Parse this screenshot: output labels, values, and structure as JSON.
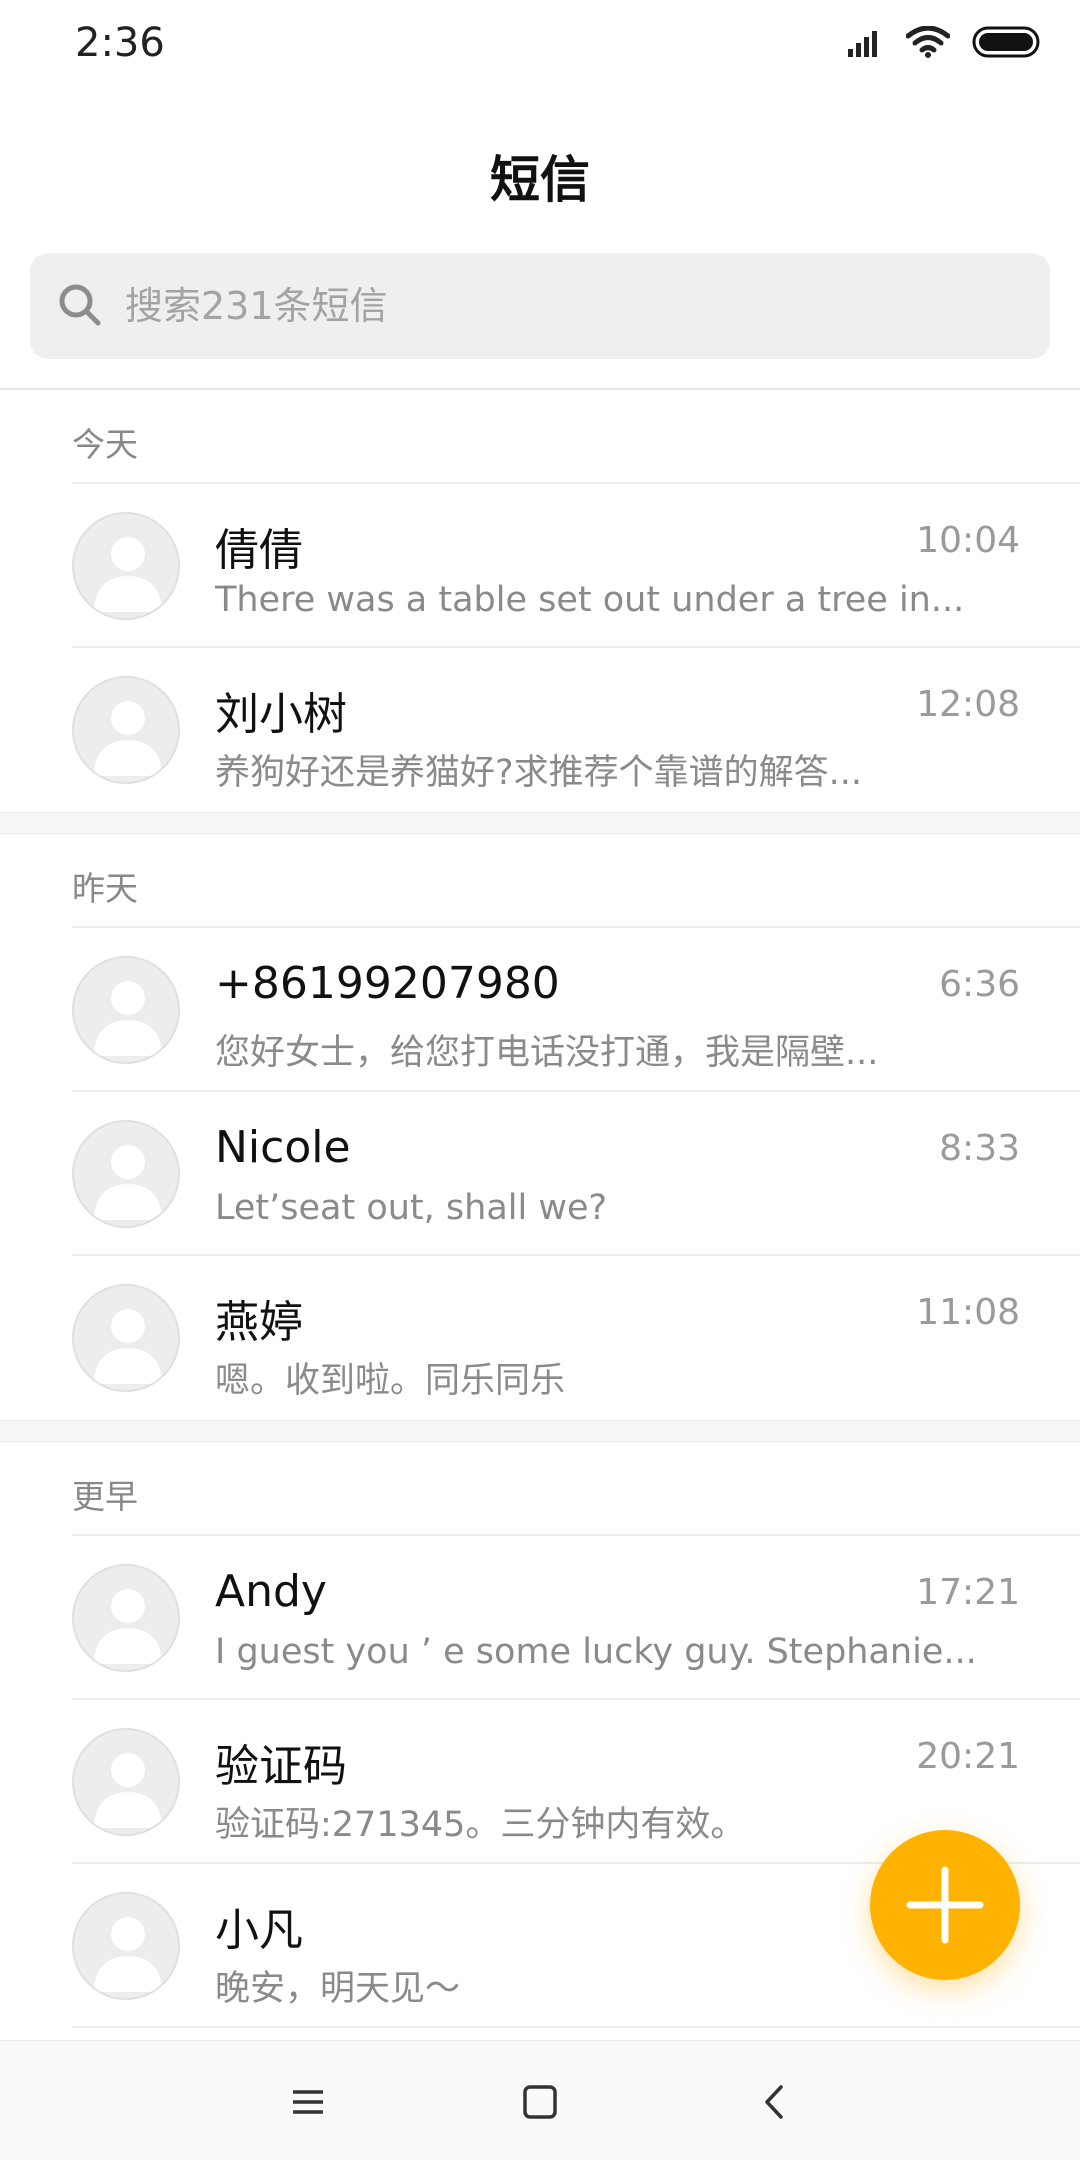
{
  "status_bar": {
    "time": "2:36"
  },
  "header": {
    "title": "短信"
  },
  "search": {
    "placeholder": "搜索231条短信"
  },
  "sections": [
    {
      "label": "今天",
      "conversations": [
        {
          "name": "倩倩",
          "time": "10:04",
          "preview": "There was a table set out under a tree in..."
        },
        {
          "name": "刘小树",
          "time": "12:08",
          "preview": "养狗好还是养猫好?求推荐个靠谱的解答..."
        }
      ]
    },
    {
      "label": "昨天",
      "conversations": [
        {
          "name": "+86199207980",
          "time": "6:36",
          "preview": "您好女士，给您打电话没打通，我是隔壁..."
        },
        {
          "name": "Nicole",
          "time": "8:33",
          "preview": "Let’seat out, shall we?"
        },
        {
          "name": "燕婷",
          "time": "11:08",
          "preview": "嗯。收到啦。同乐同乐"
        }
      ]
    },
    {
      "label": "更早",
      "conversations": [
        {
          "name": "Andy",
          "time": "17:21",
          "preview": "I guest you ’ e some lucky guy. Stephanie..."
        },
        {
          "name": "验证码",
          "time": "20:21",
          "preview": "验证码:271345。三分钟内有效。"
        },
        {
          "name": "小凡",
          "time": "",
          "preview": "晚安，明天见～"
        }
      ]
    }
  ],
  "colors": {
    "accent": "#ffb300",
    "background": "#ffffff",
    "secondary_text": "#8a8a8a"
  },
  "icons": [
    "signal-icon",
    "wifi-icon",
    "battery-icon",
    "search-icon",
    "plus-icon",
    "menu-icon",
    "home-icon",
    "back-icon"
  ]
}
